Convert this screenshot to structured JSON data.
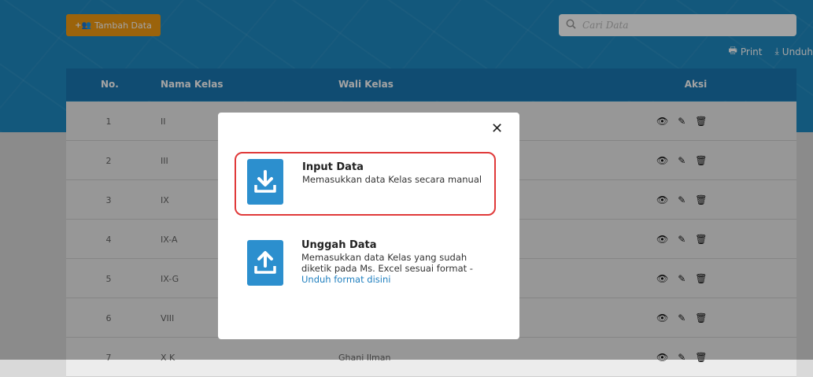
{
  "toolbar": {
    "add_label": "Tambah Data",
    "print_label": "Print",
    "download_label": "Unduh"
  },
  "search": {
    "placeholder": "Cari Data",
    "value": ""
  },
  "table": {
    "headers": {
      "no": "No.",
      "name": "Nama Kelas",
      "wali": "Wali Kelas",
      "aksi": "Aksi"
    },
    "rows": [
      {
        "no": "1",
        "name": "II",
        "wali": ""
      },
      {
        "no": "2",
        "name": "III",
        "wali": ""
      },
      {
        "no": "3",
        "name": "IX",
        "wali": ""
      },
      {
        "no": "4",
        "name": "IX-A",
        "wali": ""
      },
      {
        "no": "5",
        "name": "IX-G",
        "wali": ""
      },
      {
        "no": "6",
        "name": "VIII",
        "wali": ""
      },
      {
        "no": "7",
        "name": "X K",
        "wali": "Ghani Ilman"
      }
    ]
  },
  "modal": {
    "close": "✕",
    "input": {
      "title": "Input Data",
      "description": "Memasukkan data Kelas secara manual"
    },
    "upload": {
      "title": "Unggah Data",
      "description": "Memasukkan data Kelas yang sudah diketik pada Ms. Excel sesuai format -",
      "link": "Unduh format disini"
    }
  },
  "colors": {
    "primary": "#1f8ac2",
    "header": "#1a78b3",
    "accent": "#f39c12",
    "highlight": "#e03a3a",
    "option_icon": "#2c8fce"
  },
  "icons": {
    "add": "add-users-icon",
    "search": "search-icon",
    "print": "print-icon",
    "download": "download-icon",
    "view": "eye-icon",
    "edit": "edit-icon",
    "delete": "trash-icon"
  }
}
